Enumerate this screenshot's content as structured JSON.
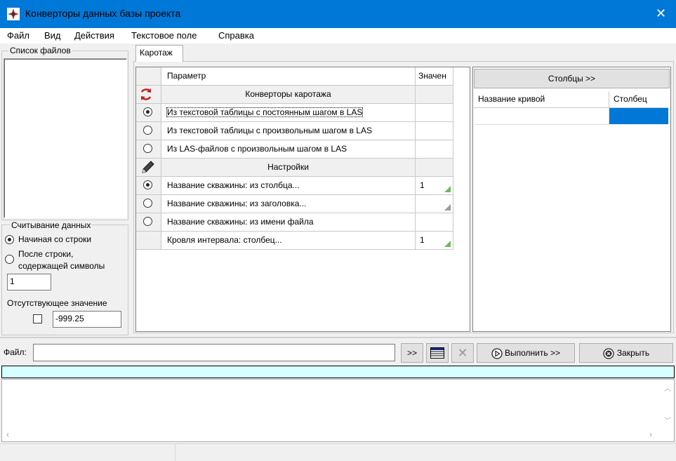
{
  "window": {
    "title": "Конверторы данных базы проекта"
  },
  "menu": [
    "Файл",
    "Вид",
    "Действия",
    "Текстовое поле",
    "Справка"
  ],
  "left_panel": {
    "file_list_title": "Список файлов",
    "read_group_title": "Считывание данных",
    "radio_start_row": "Начиная со строки",
    "radio_after_row_line1": "После строки,",
    "radio_after_row_line2": "содержащей символы",
    "start_row_value": "1",
    "missing_value_label": "Отсутствующее значение",
    "missing_value": "-999.25"
  },
  "tab": {
    "label": "Каротаж"
  },
  "grid": {
    "col_param": "Параметр",
    "col_value": "Значен",
    "section_converters": "Конверторы каротажа",
    "rows_converters": [
      {
        "label": "Из текстовой таблицы с постоянным шагом в LAS",
        "selected": true
      },
      {
        "label": "Из текстовой таблицы с произвольным шагом в LAS",
        "selected": false
      },
      {
        "label": "Из LAS-файлов с произвольным шагом в LAS",
        "selected": false
      }
    ],
    "section_settings": "Настройки",
    "rows_settings": [
      {
        "label": "Название скважины: из столбца...",
        "value": "1",
        "selected": true
      },
      {
        "label": "Название скважины: из заголовка...",
        "value": "",
        "selected": false
      },
      {
        "label": "Название скважины: из имени файла",
        "value": "",
        "selected": false
      },
      {
        "label": "Кровля интервала: столбец...",
        "value": "1"
      }
    ]
  },
  "right_panel": {
    "columns_button": "Столбцы >>",
    "col_curve_name": "Название кривой",
    "col_column": "Столбец"
  },
  "bottom": {
    "file_label": "Файл:",
    "file_value": "",
    "browse_label": ">>",
    "run_label": "Выполнить >>",
    "close_label": "Закрыть"
  },
  "colors": {
    "titlebar": "#0078d7",
    "progress": "#d6ffff",
    "selection": "#0078d7"
  }
}
